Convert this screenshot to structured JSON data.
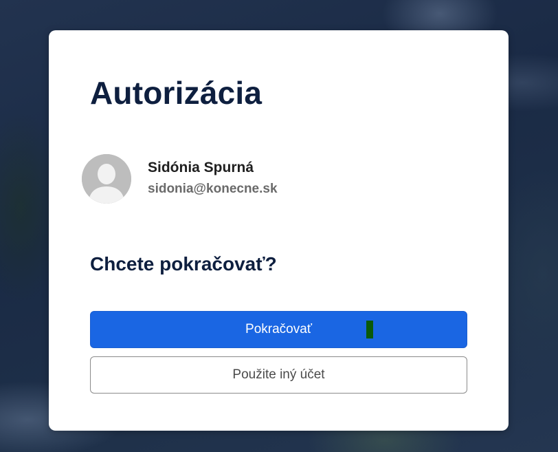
{
  "dialog": {
    "title": "Autorizácia",
    "question": "Chcete pokračovať?"
  },
  "account": {
    "name": "Sidónia Spurná",
    "email": "sidonia@konecne.sk",
    "avatar_icon": "default-user-avatar-icon"
  },
  "buttons": {
    "continue_label": "Pokračovať",
    "other_account_label": "Použite iný účet"
  },
  "colors": {
    "primary": "#1a66e3",
    "heading": "#0e1f3f",
    "background": "#1c2c48"
  }
}
